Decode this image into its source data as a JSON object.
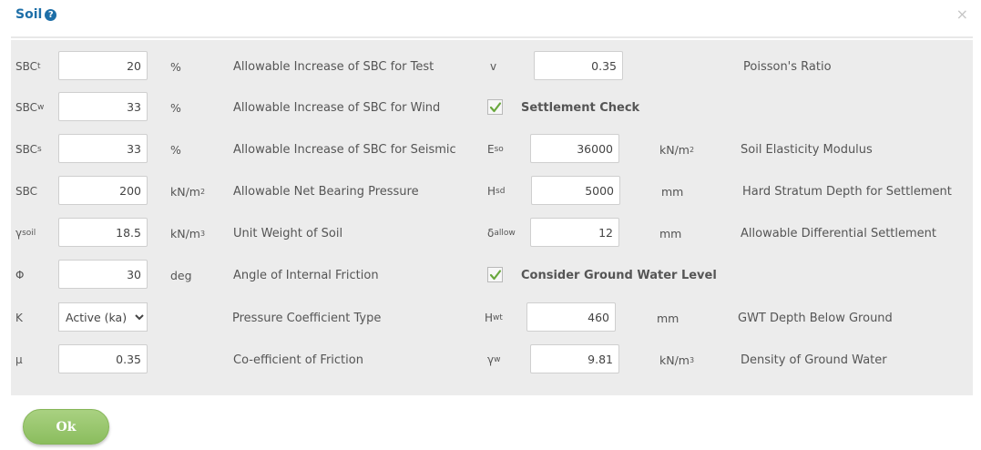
{
  "dialog": {
    "title": "Soil",
    "help_icon": "?",
    "close_icon": "×"
  },
  "rows": {
    "r1": {
      "sym_main": "SBC",
      "sym_sub": "t",
      "value": "20",
      "unit": "%",
      "desc": "Allowable Increase of SBC for Test",
      "right_sym_main": "v",
      "right_value": "0.35",
      "right_desc": "Poisson's Ratio"
    },
    "r2": {
      "sym_main": "SBC",
      "sym_sub": "w",
      "value": "33",
      "unit": "%",
      "desc": "Allowable Increase of SBC for Wind",
      "check_label": "Settlement Check",
      "checked": true
    },
    "r3": {
      "sym_main": "SBC",
      "sym_sub": "s",
      "value": "33",
      "unit": "%",
      "desc": "Allowable Increase of SBC for Seismic",
      "right_sym_main": "E",
      "right_sym_sub": "so",
      "right_value": "36000",
      "right_unit_main": "kN/m",
      "right_unit_sup": "2",
      "right_desc": "Soil Elasticity Modulus"
    },
    "r4": {
      "sym_main": "SBC",
      "value": "200",
      "unit_main": "kN/m",
      "unit_sup": "2",
      "desc": "Allowable Net Bearing Pressure",
      "right_sym_main": "H",
      "right_sym_sub": "sd",
      "right_value": "5000",
      "right_unit": "mm",
      "right_desc": "Hard Stratum Depth for Settlement"
    },
    "r5": {
      "sym_main": "γ",
      "sym_sub": "soil",
      "value": "18.5",
      "unit_main": "kN/m",
      "unit_sup": "3",
      "desc": "Unit Weight of Soil",
      "right_sym_main": "δ",
      "right_sym_sub": "allow",
      "right_value": "12",
      "right_unit": "mm",
      "right_desc": "Allowable Differential Settlement"
    },
    "r6": {
      "sym_main": "Φ",
      "value": "30",
      "unit": "deg",
      "desc": "Angle of Internal Friction",
      "check_label": "Consider Ground Water Level",
      "checked": true
    },
    "r7": {
      "sym_main": "K",
      "select_value": "Active (ka)",
      "desc": "Pressure Coefficient Type",
      "right_sym_main": "H",
      "right_sym_sub": "wt",
      "right_value": "460",
      "right_unit": "mm",
      "right_desc": "GWT Depth Below Ground"
    },
    "r8": {
      "sym_main": "μ",
      "value": "0.35",
      "desc": "Co-efficient of Friction",
      "right_sym_main": "γ",
      "right_sym_sub": "w",
      "right_value": "9.81",
      "right_unit_main": "kN/m",
      "right_unit_sup": "3",
      "right_desc": "Density of Ground Water"
    }
  },
  "footer": {
    "ok_label": "Ok"
  },
  "colors": {
    "title": "#1e6fa8",
    "panel_bg": "#ececec",
    "ok_button": "#97c56d",
    "checkmark": "#6aa83e"
  },
  "icons": {
    "help": "help-circle-icon",
    "close": "close-icon",
    "check": "checkmark-icon",
    "select_arrow": "chevron-down-icon"
  }
}
